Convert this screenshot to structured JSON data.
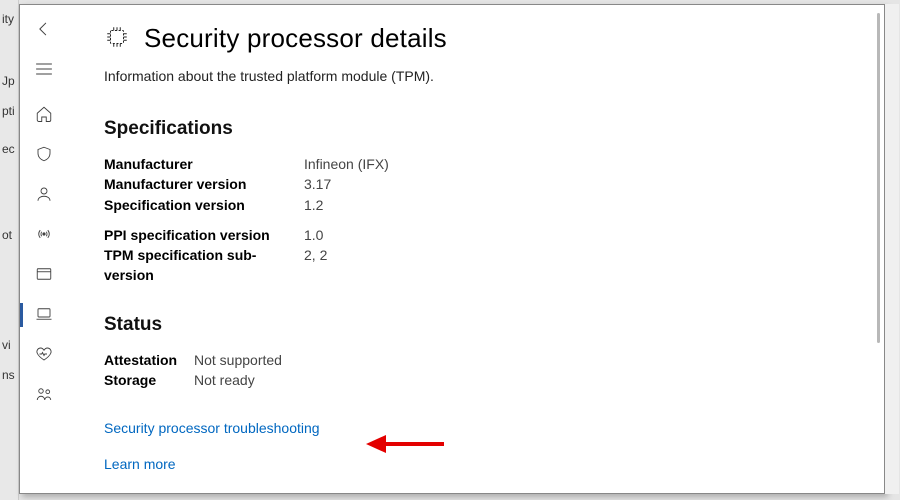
{
  "bg_items": [
    "ity",
    "",
    "Jp",
    "pti",
    "ec",
    "",
    "",
    "ot",
    "",
    "",
    "",
    "vi",
    "ns"
  ],
  "page": {
    "title": "Security processor details",
    "subtitle": "Information about the trusted platform module (TPM)."
  },
  "sections": {
    "specifications": {
      "heading": "Specifications",
      "group1": [
        {
          "key": "Manufacturer",
          "val": "Infineon (IFX)"
        },
        {
          "key": "Manufacturer version",
          "val": "3.17"
        },
        {
          "key": "Specification version",
          "val": "1.2"
        }
      ],
      "group2": [
        {
          "key": "PPI specification version",
          "val": "1.0"
        },
        {
          "key": "TPM specification sub-version",
          "val": "2, 2"
        }
      ]
    },
    "status": {
      "heading": "Status",
      "rows": [
        {
          "key": "Attestation",
          "val": "Not supported"
        },
        {
          "key": "Storage",
          "val": "Not ready"
        }
      ]
    }
  },
  "links": {
    "troubleshoot": "Security processor troubleshooting",
    "learn_more": "Learn more"
  }
}
